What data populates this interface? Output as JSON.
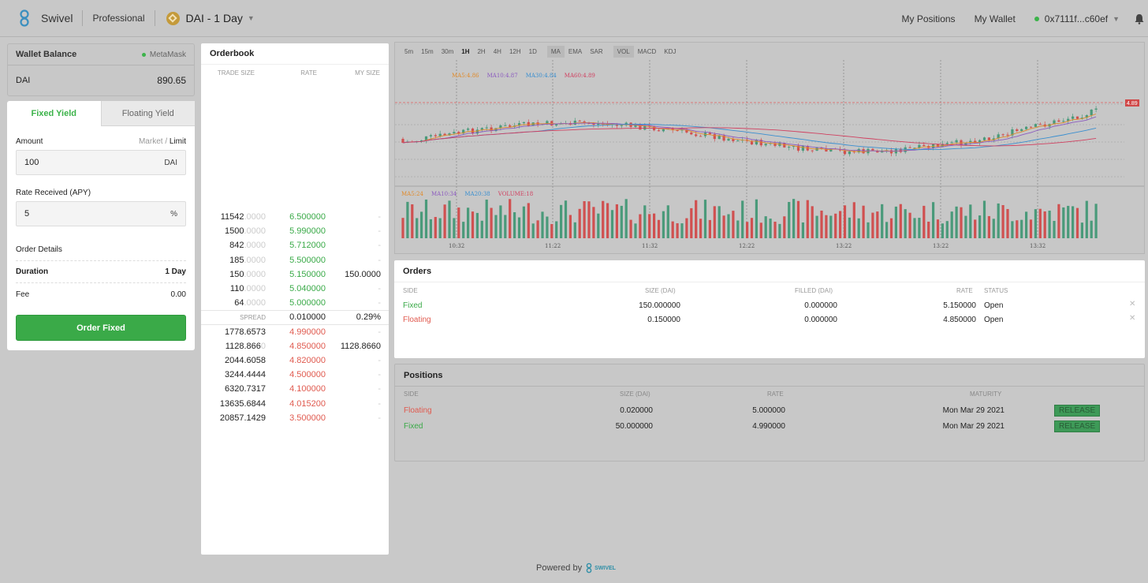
{
  "header": {
    "brand": "Swivel",
    "mode": "Professional",
    "market": "DAI - 1 Day",
    "nav": [
      "My Positions",
      "My Wallet"
    ],
    "address": "0x7111f...c60ef"
  },
  "wallet": {
    "title": "Wallet Balance",
    "provider": "MetaMask",
    "token": "DAI",
    "balance": "890.65"
  },
  "form": {
    "tabs": [
      "Fixed Yield",
      "Floating Yield"
    ],
    "amount_label": "Amount",
    "market_label": "Market",
    "separator": "/",
    "limit_label": "Limit",
    "amount_value": "100",
    "amount_unit": "DAI",
    "rate_label": "Rate Received (APY)",
    "rate_value": "5",
    "rate_unit": "%",
    "details_title": "Order Details",
    "duration_label": "Duration",
    "duration_value": "1 Day",
    "fee_label": "Fee",
    "fee_value": "0.00",
    "submit": "Order Fixed"
  },
  "orderbook": {
    "title": "Orderbook",
    "columns": [
      "TRADE SIZE",
      "RATE",
      "MY SIZE"
    ],
    "asks": [
      {
        "size": "11542",
        "tail": ".0000",
        "rate": "6.500000",
        "my": "-"
      },
      {
        "size": "1500",
        "tail": ".0000",
        "rate": "5.990000",
        "my": "-"
      },
      {
        "size": "842",
        "tail": ".0000",
        "rate": "5.712000",
        "my": "-"
      },
      {
        "size": "185",
        "tail": ".0000",
        "rate": "5.500000",
        "my": "-"
      },
      {
        "size": "150",
        "tail": ".0000",
        "rate": "5.150000",
        "my": "150.0000"
      },
      {
        "size": "110",
        "tail": ".0000",
        "rate": "5.040000",
        "my": "-"
      },
      {
        "size": "64",
        "tail": ".0000",
        "rate": "5.000000",
        "my": "-"
      }
    ],
    "spread": {
      "label": "SPREAD",
      "value": "0.010000",
      "pct": "0.29%"
    },
    "bids": [
      {
        "size": "1778.6573",
        "tail": "",
        "rate": "4.990000",
        "my": "-"
      },
      {
        "size": "1128.866",
        "tail": "0",
        "rate": "4.850000",
        "my": "1128.8660"
      },
      {
        "size": "2044.6058",
        "tail": "",
        "rate": "4.820000",
        "my": "-"
      },
      {
        "size": "3244.4444",
        "tail": "",
        "rate": "4.500000",
        "my": "-"
      },
      {
        "size": "6320.7317",
        "tail": "",
        "rate": "4.100000",
        "my": "-"
      },
      {
        "size": "13635.6844",
        "tail": "",
        "rate": "4.015200",
        "my": "-"
      },
      {
        "size": "20857.1429",
        "tail": "",
        "rate": "3.500000",
        "my": "-"
      }
    ]
  },
  "chart": {
    "intervals": [
      "5m",
      "15m",
      "30m",
      "1H",
      "2H",
      "4H",
      "12H",
      "1D"
    ],
    "selected_interval": "1H",
    "main_indicators": [
      "MA",
      "EMA",
      "SAR"
    ],
    "sub_indicators": [
      "VOL",
      "MACD",
      "KDJ"
    ],
    "ma_legend": [
      {
        "text": "MA5:4.86",
        "color": "#e08a2a"
      },
      {
        "text": "MA10:4.87",
        "color": "#8c5bbf"
      },
      {
        "text": "MA30:4.84",
        "color": "#3a8fd0"
      },
      {
        "text": "MA60:4.89",
        "color": "#d04060"
      }
    ],
    "vol_legend": [
      {
        "text": "MA5:24",
        "color": "#e08a2a"
      },
      {
        "text": "MA10:34",
        "color": "#8c5bbf"
      },
      {
        "text": "MA20:38",
        "color": "#3a8fd0"
      },
      {
        "text": "VOLUME:18",
        "color": "#d04060"
      }
    ],
    "price_tag": "4.89",
    "time_labels": [
      "10:32",
      "11:22",
      "11:32",
      "12:22",
      "13:22",
      "13:22",
      "13:32"
    ]
  },
  "orders": {
    "title": "Orders",
    "columns": [
      "SIDE",
      "SIZE (DAI)",
      "FILLED (DAI)",
      "RATE",
      "STATUS"
    ],
    "rows": [
      {
        "side": "Fixed",
        "size": "150.000000",
        "filled": "0.000000",
        "rate": "5.150000",
        "status": "Open"
      },
      {
        "side": "Floating",
        "size": "0.150000",
        "filled": "0.000000",
        "rate": "4.850000",
        "status": "Open"
      }
    ]
  },
  "positions": {
    "title": "Positions",
    "columns": [
      "SIDE",
      "SIZE (DAI)",
      "RATE",
      "MATURITY"
    ],
    "rows": [
      {
        "side": "Floating",
        "size": "0.020000",
        "rate": "5.000000",
        "maturity": "Mon Mar 29 2021",
        "action": "RELEASE"
      },
      {
        "side": "Fixed",
        "size": "50.000000",
        "rate": "4.990000",
        "maturity": "Mon Mar 29 2021",
        "action": "RELEASE"
      }
    ]
  },
  "footer": {
    "text": "Powered by",
    "brand": "SWIVEL"
  }
}
